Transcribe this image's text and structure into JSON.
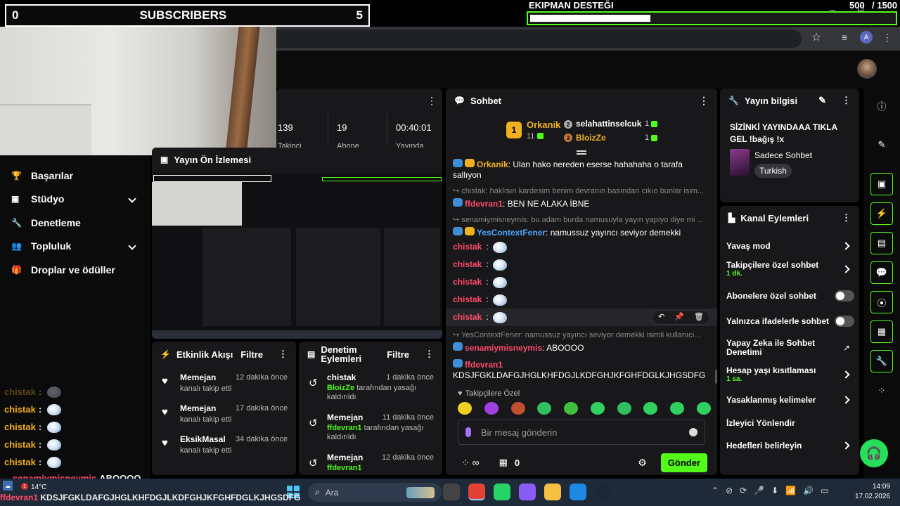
{
  "overlay": {
    "sub_count_left": "0",
    "sub_title": "SUBSCRIBERS",
    "sub_count_right": "5",
    "goal_title": "EKIPMAN DESTEĞI",
    "goal_current": "500",
    "goal_total": "/ 1500",
    "goal_progress": 0.33
  },
  "sidebar": {
    "items": [
      {
        "label": "Başarılar",
        "icon": "trophy-icon"
      },
      {
        "label": "Stüdyo",
        "icon": "studio-icon"
      },
      {
        "label": "Denetleme",
        "icon": "wrench-icon"
      },
      {
        "label": "Topluluk",
        "icon": "people-icon"
      },
      {
        "label": "Droplar ve ödüller",
        "icon": "gift-icon"
      }
    ]
  },
  "stats": {
    "followers_value": "139",
    "followers_label": "Takipçi",
    "viewers_value": "19",
    "viewers_label": "Abone",
    "time_value": "00:40:01",
    "time_label": "Yayında"
  },
  "preview": {
    "title": "Yayın Ön İzlemesi"
  },
  "activity": {
    "title": "Etkinlik Akışı",
    "filter": "Filtre",
    "items": [
      {
        "name": "Memejan",
        "time": "12 dakika önce",
        "desc": "kanalı takip etti"
      },
      {
        "name": "Memejan",
        "time": "17 dakika önce",
        "desc": "kanalı takip etti"
      },
      {
        "name": "EksikMasal",
        "time": "34 dakika önce",
        "desc": "kanalı takip etti"
      }
    ]
  },
  "mod": {
    "title": "Denetim Eylemleri",
    "filter": "Filtre",
    "items": [
      {
        "name": "chistak",
        "time": "1 dakika önce",
        "actor": "BloizZe",
        "desc": "tarafından yasağı kaldırıldı"
      },
      {
        "name": "Memejan",
        "time": "11 dakika önce",
        "actor": "ffdevran1",
        "desc": "tarafından yasağı kaldırıldı"
      },
      {
        "name": "Memejan",
        "time": "12 dakika önce",
        "actor": "ffdevran1",
        "desc": ""
      }
    ]
  },
  "chat": {
    "title": "Sohbet",
    "top1": {
      "rank": "1",
      "name": "Orkanik",
      "count": "11"
    },
    "top2": {
      "rank": "2",
      "name": "selahattinselcuk",
      "count": "1"
    },
    "top3": {
      "rank": "3",
      "name": "BloizZe",
      "count": "1"
    },
    "messages": [
      {
        "user": "Orkanik",
        "color": "#f0b020",
        "text": "Ulan hako nereden eserse hahahaha o tarafa sallıyon",
        "reply": ""
      },
      {
        "user": "ffdevran1",
        "color": "#ff4a6a",
        "text": "BEN NE ALAKA İBNE",
        "reply": "chistak: haklısın kardesim benim devranın basından cıkıo bunlar isim..."
      },
      {
        "user": "YesContextFener",
        "color": "#4aa8ff",
        "text": "namussuz yayıncı seviyor demekki",
        "reply": "senamiymisneymis: bu adam burda namusuyla yayın yapıyo diye mi ..."
      }
    ],
    "emote_user": "chistak",
    "senami_reply": "YesContextFener: namussuz yayıncı seviyor demekki isimli kullanıcı...",
    "senami_user": "senamiymisneymis",
    "senami_text": "ABOOOO",
    "ff_user": "ffdevran1",
    "ff_text": "KDSJFGKLDAFGJHGLKHFDGJLKDFGHJKFGHFDGLKJHGSDFG",
    "followers_only": "Takipçilere Özel",
    "input_placeholder": "Bir mesaj gönderin",
    "send": "Gönder",
    "points": "0"
  },
  "info": {
    "title": "Yayın bilgisi",
    "stream_title": "SİZİNKİ YAYINDAAA TIKLA GEL !bağış !x",
    "category": "Sadece Sohbet",
    "tag": "Turkish"
  },
  "actions": {
    "title": "Kanal Eylemleri",
    "items": [
      {
        "label": "Yavaş mod",
        "sub": "",
        "ctrl": "chevron"
      },
      {
        "label": "Takipçilere özel sohbet",
        "sub": "1 dk.",
        "ctrl": "chevron"
      },
      {
        "label": "Abonelere özel sohbet",
        "sub": "",
        "ctrl": "toggle"
      },
      {
        "label": "Yalnızca ifadelerle sohbet",
        "sub": "",
        "ctrl": "toggle"
      },
      {
        "label": "Yapay Zeka ile Sohbet Denetimi",
        "sub": "",
        "ctrl": "external"
      },
      {
        "label": "Hesap yaşı kısıtlaması",
        "sub": "1 sa.",
        "ctrl": "chevron"
      },
      {
        "label": "Yasaklanmış kelimeler",
        "sub": "",
        "ctrl": "chevron"
      },
      {
        "label": "İzleyici Yönlendir",
        "sub": "",
        "ctrl": "none"
      },
      {
        "label": "Hedefleri belirleyin",
        "sub": "",
        "ctrl": "chevron"
      }
    ]
  },
  "overlay_chat": {
    "user": "chistak",
    "last_user": "senamiymisneymis",
    "last_text": "ABOOOO",
    "ff_user": "ffdevran1",
    "ff_text": "KDSJFGKLDAFGJHGLKHFDGJLKDFGHJKFGHFDGLKJHGSDFG"
  },
  "taskbar": {
    "weather_temp": "14°C",
    "search": "Ara",
    "time": "14:09",
    "date": "17.02.2026"
  },
  "browser": {
    "avatar_letter": "A"
  }
}
